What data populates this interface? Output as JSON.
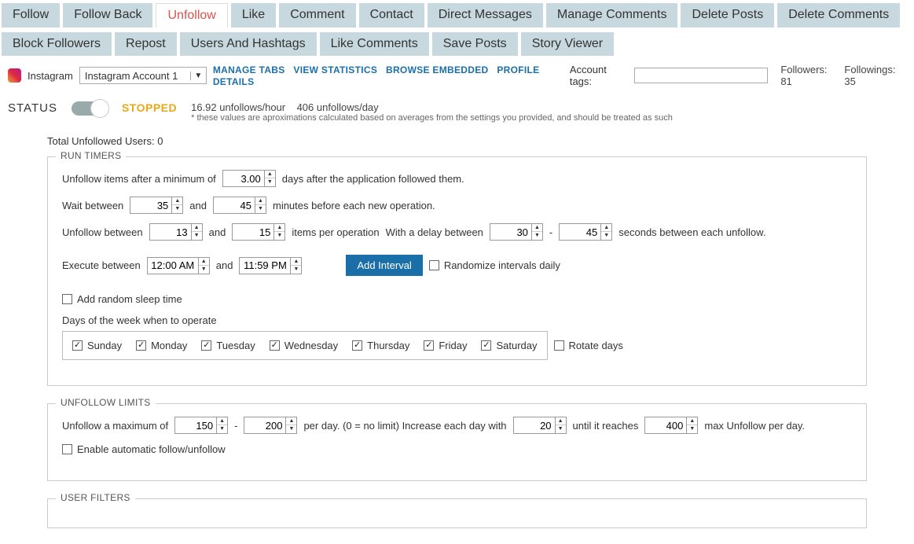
{
  "tabs_row1": [
    "Follow",
    "Follow Back",
    "Unfollow",
    "Like",
    "Comment",
    "Contact",
    "Direct Messages",
    "Manage Comments",
    "Delete Posts",
    "Delete Comments"
  ],
  "tabs_row2": [
    "Block Followers",
    "Repost",
    "Users And Hashtags",
    "Like Comments",
    "Save Posts",
    "Story Viewer"
  ],
  "active_tab": "Unfollow",
  "toolbar": {
    "platform": "Instagram",
    "account": "Instagram Account 1",
    "links": [
      "MANAGE TABS",
      "VIEW STATISTICS",
      "BROWSE EMBEDDED",
      "PROFILE DETAILS"
    ],
    "account_tags_label": "Account tags:",
    "account_tags_value": "",
    "followers_label": "Followers:",
    "followers": 81,
    "followings_label": "Followings:",
    "followings": 35
  },
  "status": {
    "label": "STATUS",
    "value": "STOPPED",
    "rate_hour": "16.92",
    "rate_hour_label": "unfollows/hour",
    "rate_day": "406",
    "rate_day_label": "unfollows/day",
    "note": "* these values are aproximations calculated based on averages from the settings you provided, and should be treated as such"
  },
  "total_unfollowed": {
    "label": "Total Unfollowed Users:",
    "value": 0
  },
  "run_timers": {
    "legend": "RUN TIMERS",
    "line1_a": "Unfollow items after a minimum of",
    "min_days": "3.00",
    "line1_b": "days after the application followed them.",
    "wait_label": "Wait between",
    "wait_lo": "35",
    "and": "and",
    "wait_hi": "45",
    "wait_tail": "minutes before each new operation.",
    "ub_label": "Unfollow between",
    "ub_lo": "13",
    "ub_hi": "15",
    "ub_tail1": "items per operation",
    "ub_tail2": "With a delay between",
    "delay_lo": "30",
    "dash": "-",
    "delay_hi": "45",
    "ub_tail3": "seconds between each unfollow.",
    "exec_label": "Execute between",
    "exec_lo": "12:00 AM",
    "exec_hi": "11:59 PM",
    "add_interval": "Add Interval",
    "randomize": "Randomize intervals daily",
    "add_sleep": "Add random sleep time",
    "days_label": "Days of the week when to operate",
    "days": [
      "Sunday",
      "Monday",
      "Tuesday",
      "Wednesday",
      "Thursday",
      "Friday",
      "Saturday"
    ],
    "rotate": "Rotate days"
  },
  "limits": {
    "legend": "UNFOLLOW LIMITS",
    "a": "Unfollow a maximum of",
    "lo": "150",
    "dash": "-",
    "hi": "200",
    "b": "per day. (0 = no limit)   Increase each day with",
    "inc": "20",
    "c": "until it reaches",
    "max": "400",
    "d": "max Unfollow per day.",
    "enable": "Enable automatic follow/unfollow"
  },
  "user_filters": {
    "legend": "USER FILTERS"
  }
}
